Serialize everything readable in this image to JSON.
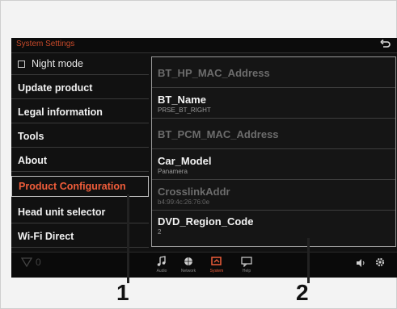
{
  "app": {
    "title": "System Settings"
  },
  "menu": {
    "items": [
      {
        "label": "Night mode"
      },
      {
        "label": "Update product"
      },
      {
        "label": "Legal information"
      },
      {
        "label": "Tools"
      },
      {
        "label": "About"
      },
      {
        "label": "Product Configuration"
      },
      {
        "label": "Head unit selector"
      },
      {
        "label": "Wi-Fi Direct"
      }
    ]
  },
  "panel": {
    "rows": [
      {
        "name": "BT_HP_MAC_Address",
        "value": ""
      },
      {
        "name": "BT_Name",
        "value": "PRSE_BT_RIGHT"
      },
      {
        "name": "BT_PCM_MAC_Address",
        "value": ""
      },
      {
        "name": "Car_Model",
        "value": "Panamera"
      },
      {
        "name": "CrosslinkAddr",
        "value": "b4:99:4c:26:76:0e"
      },
      {
        "name": "DVD_Region_Code",
        "value": "2"
      }
    ]
  },
  "bottom": {
    "status_number": "0",
    "tabs": [
      {
        "label": "Audio",
        "icon": "music-note-icon"
      },
      {
        "label": "Network",
        "icon": "globe-icon"
      },
      {
        "label": "System",
        "icon": "system-icon"
      },
      {
        "label": "Help",
        "icon": "help-icon"
      }
    ]
  },
  "callouts": {
    "one": "1",
    "two": "2"
  },
  "colors": {
    "accent": "#f05d3a",
    "title": "#c94a2a"
  }
}
